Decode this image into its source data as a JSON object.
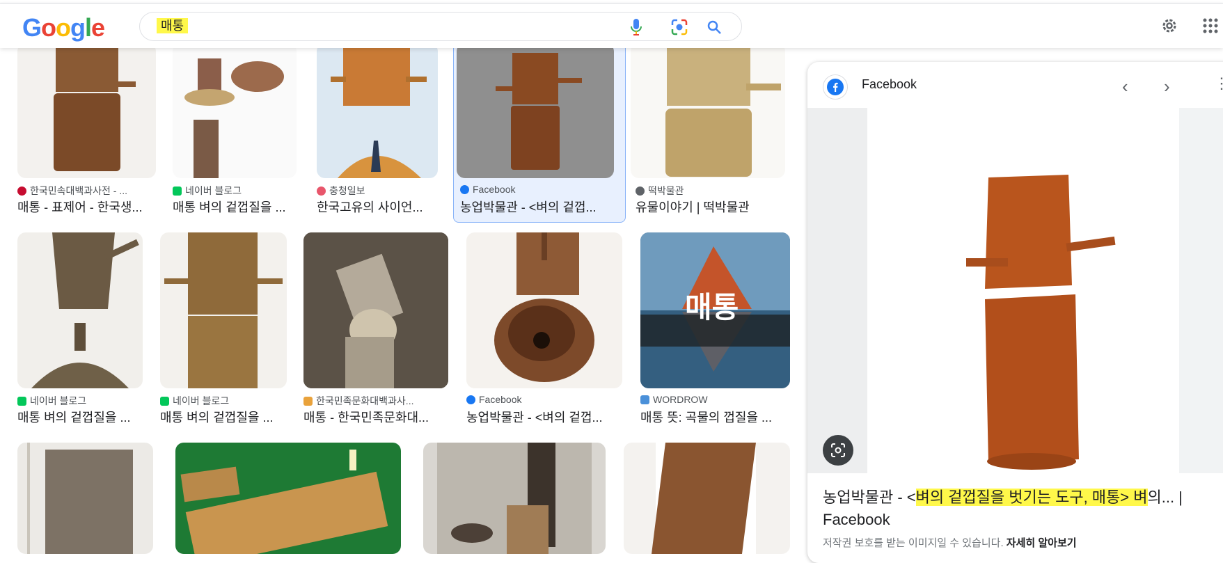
{
  "logo": "Google",
  "search": {
    "query": "매통"
  },
  "icons": {
    "mic": "mic-icon",
    "lens": "camera-lens-icon",
    "search": "search-icon",
    "settings": "gear-icon",
    "apps": "apps-grid-icon"
  },
  "results": [
    {
      "source": "한국민속대백과사전 - ...",
      "title": "매통 - 표제어 - 한국생...",
      "fav_color": "#c60c30"
    },
    {
      "source": "네이버 블로그",
      "title": "매통 벼의 겉껍질을 ...",
      "fav_color": "#03c75a"
    },
    {
      "source": "충청일보",
      "title": "한국고유의 사이언...",
      "fav_color": "#e8566b"
    },
    {
      "source": "Facebook",
      "title": "농업박물관 - <벼의 겉껍...",
      "fav_color": "#1877f2"
    },
    {
      "source": "떡박물관",
      "title": "유물이야기 | 떡박물관",
      "fav_color": "#5f6368"
    },
    {
      "source": "네이버 블로그",
      "title": "매통 벼의 겉껍질을 ...",
      "fav_color": "#03c75a"
    },
    {
      "source": "네이버 블로그",
      "title": "매통 벼의 겉껍질을 ...",
      "fav_color": "#03c75a"
    },
    {
      "source": "한국민족문화대백과사...",
      "title": "매통 - 한국민족문화대...",
      "fav_color": "#e9a23b"
    },
    {
      "source": "Facebook",
      "title": "농업박물관 - <벼의 겉껍...",
      "fav_color": "#1877f2"
    },
    {
      "source": "WORDROW",
      "title": "매통 뜻: 곡물의 껍질을 ...",
      "fav_color": "#4a90d9"
    }
  ],
  "thumb_overlay_text": "매통",
  "panel": {
    "source": "Facebook",
    "title_prefix": "농업박물관 - <",
    "title_highlight": "벼의 겉껍질을 벗기는 도구, 매통> 벼",
    "title_suffix": "의... | Facebook",
    "note": "저작권 보호를 받는 이미지일 수 있습니다.",
    "note_link": "자세히 알아보기"
  }
}
